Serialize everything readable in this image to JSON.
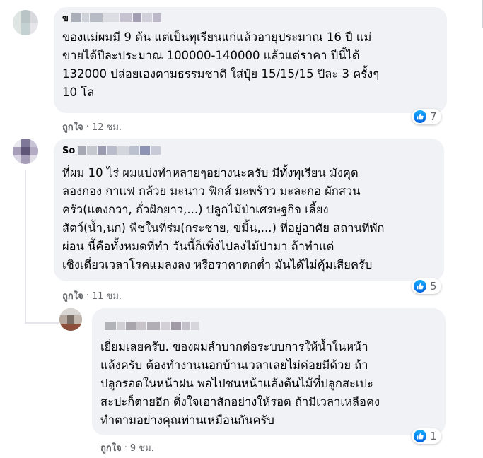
{
  "comments": [
    {
      "author_partial": "ข",
      "lines": [
        "ของแม่ผมมี 9 ต้น แต่เป็นทุเรียนแก่แล้วอายุประมาณ 16 ปี แม่",
        "ขายได้ปีละประมาณ 100000-140000 แล้วแต่ราคา ปีนี้ได้",
        "132000 ปล่อยเองตามธรรมชาติ ใส่ปุ๋ย 15/15/15 ปีละ 3 ครั้งๆ",
        "10 โล"
      ],
      "reaction_icon": "like-icon",
      "reaction_count": "7",
      "like_label": "ถูกใจ",
      "separator": "·",
      "time": "12 ชม."
    },
    {
      "author_partial": "So",
      "lines": [
        "ที่ผม 10 ไร่ ผมแบ่งทำหลายๆอย่างนะครับ มีทั้งทุเรียน มังคุด",
        "ลองกอง กาแฟ กล้วย มะนาว ฟิกส์ มะพร้าว มะละกอ ผักสวน",
        "ครัว(แตงกวา, ถั่วฝักยาว,...) ปลูกไม้ป่าเศรษฐกิจ เลี้ยง",
        "สัตว์(น้ำ,นก) พืชในที่ร่ม(กระชาย, ขมิ้น,...) ที่อยู่อาศัย สถานที่พัก",
        "ผ่อน นี้คือทั้งหมดที่ทำ วันนี้ก็เพิ่งไปลงไม้ป่ามา ถ้าทำแต่",
        "เชิงเดี่ยวเวลาโรคแมลงลง หรือราคาตกต่ำ มันได้ไม่คุ้มเสียครับ"
      ],
      "reaction_icon": "like-icon",
      "reaction_count": "5",
      "like_label": "ถูกใจ",
      "separator": "·",
      "time": "11 ชม."
    },
    {
      "author_partial": "",
      "lines": [
        "เยี่ยมเลยครับ. ของผมลำบากต่อระบบการให้น้ำในหน้า",
        "แล้งครับ ต้องทำงานนอกบ้านเวลาเลยไม่ค่อยมีด้วย ถ้า",
        "ปลูกรอดในหน้าฝน พอไปชนหน้าแล้งต้นไม้ที่ปลูกสะเปะ",
        "สะปะก็ตายอีก ดิ่งใจเอาสักอย่างให้รอด ถ้ามีเวลาเหลือคง",
        "ทำตามอย่างคุณท่านเหมือนกันครับ"
      ],
      "reaction_icon": "like-icon",
      "reaction_count": "1",
      "like_label": "ถูกใจ",
      "separator": "·",
      "time": "9 ชม."
    }
  ]
}
